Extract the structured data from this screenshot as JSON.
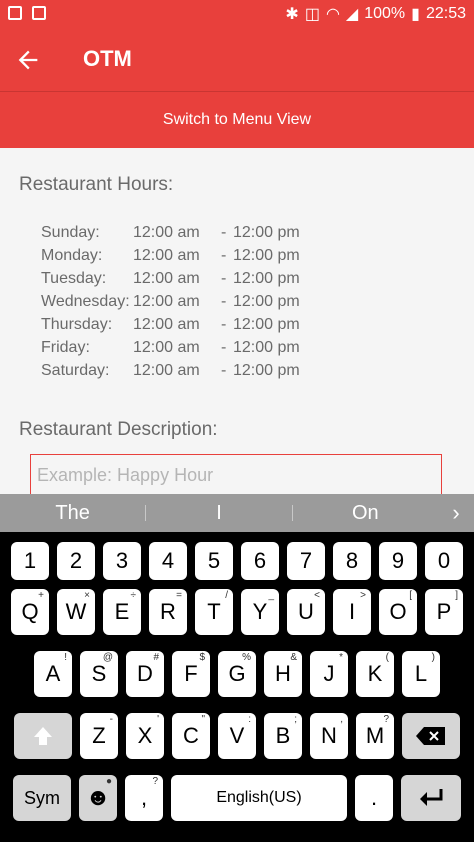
{
  "status": {
    "battery": "100%",
    "time": "22:53"
  },
  "appbar": {
    "title": "OTM"
  },
  "switch_view": "Switch to Menu View",
  "hours": {
    "heading": "Restaurant Hours:",
    "rows": [
      {
        "day": "Sunday:",
        "open": "12:00 am",
        "close": "12:00 pm"
      },
      {
        "day": "Monday:",
        "open": "12:00 am",
        "close": "12:00 pm"
      },
      {
        "day": "Tuesday:",
        "open": "12:00 am",
        "close": "12:00 pm"
      },
      {
        "day": "Wednesday:",
        "open": "12:00 am",
        "close": "12:00 pm"
      },
      {
        "day": "Thursday:",
        "open": "12:00 am",
        "close": "12:00 pm"
      },
      {
        "day": "Friday:",
        "open": "12:00 am",
        "close": "12:00 pm"
      },
      {
        "day": "Saturday:",
        "open": "12:00 am",
        "close": "12:00 pm"
      }
    ],
    "dash": "-"
  },
  "description": {
    "heading": "Restaurant Description:",
    "placeholder": "Example: Happy Hour"
  },
  "suggestions": [
    "The",
    "I",
    "On"
  ],
  "keyboard": {
    "numbers": [
      "1",
      "2",
      "3",
      "4",
      "5",
      "6",
      "7",
      "8",
      "9",
      "0"
    ],
    "row_q": [
      {
        "k": "Q",
        "s": "+"
      },
      {
        "k": "W",
        "s": "×"
      },
      {
        "k": "E",
        "s": "÷"
      },
      {
        "k": "R",
        "s": "="
      },
      {
        "k": "T",
        "s": "/"
      },
      {
        "k": "Y",
        "s": "_"
      },
      {
        "k": "U",
        "s": "<"
      },
      {
        "k": "I",
        "s": ">"
      },
      {
        "k": "O",
        "s": "["
      },
      {
        "k": "P",
        "s": "]"
      }
    ],
    "row_a": [
      {
        "k": "A",
        "s": "!"
      },
      {
        "k": "S",
        "s": "@"
      },
      {
        "k": "D",
        "s": "#"
      },
      {
        "k": "F",
        "s": "$"
      },
      {
        "k": "G",
        "s": "%"
      },
      {
        "k": "H",
        "s": "&"
      },
      {
        "k": "J",
        "s": "*"
      },
      {
        "k": "K",
        "s": "("
      },
      {
        "k": "L",
        "s": ")"
      }
    ],
    "row_z": [
      {
        "k": "Z",
        "s": "-"
      },
      {
        "k": "X",
        "s": "'"
      },
      {
        "k": "C",
        "s": "\""
      },
      {
        "k": "V",
        "s": ":"
      },
      {
        "k": "B",
        "s": ";"
      },
      {
        "k": "N",
        "s": ","
      },
      {
        "k": "M",
        "s": "?"
      }
    ],
    "sym_label": "Sym",
    "comma": ",",
    "comma_sub": "?",
    "space_label": "English(US)",
    "period": "."
  }
}
